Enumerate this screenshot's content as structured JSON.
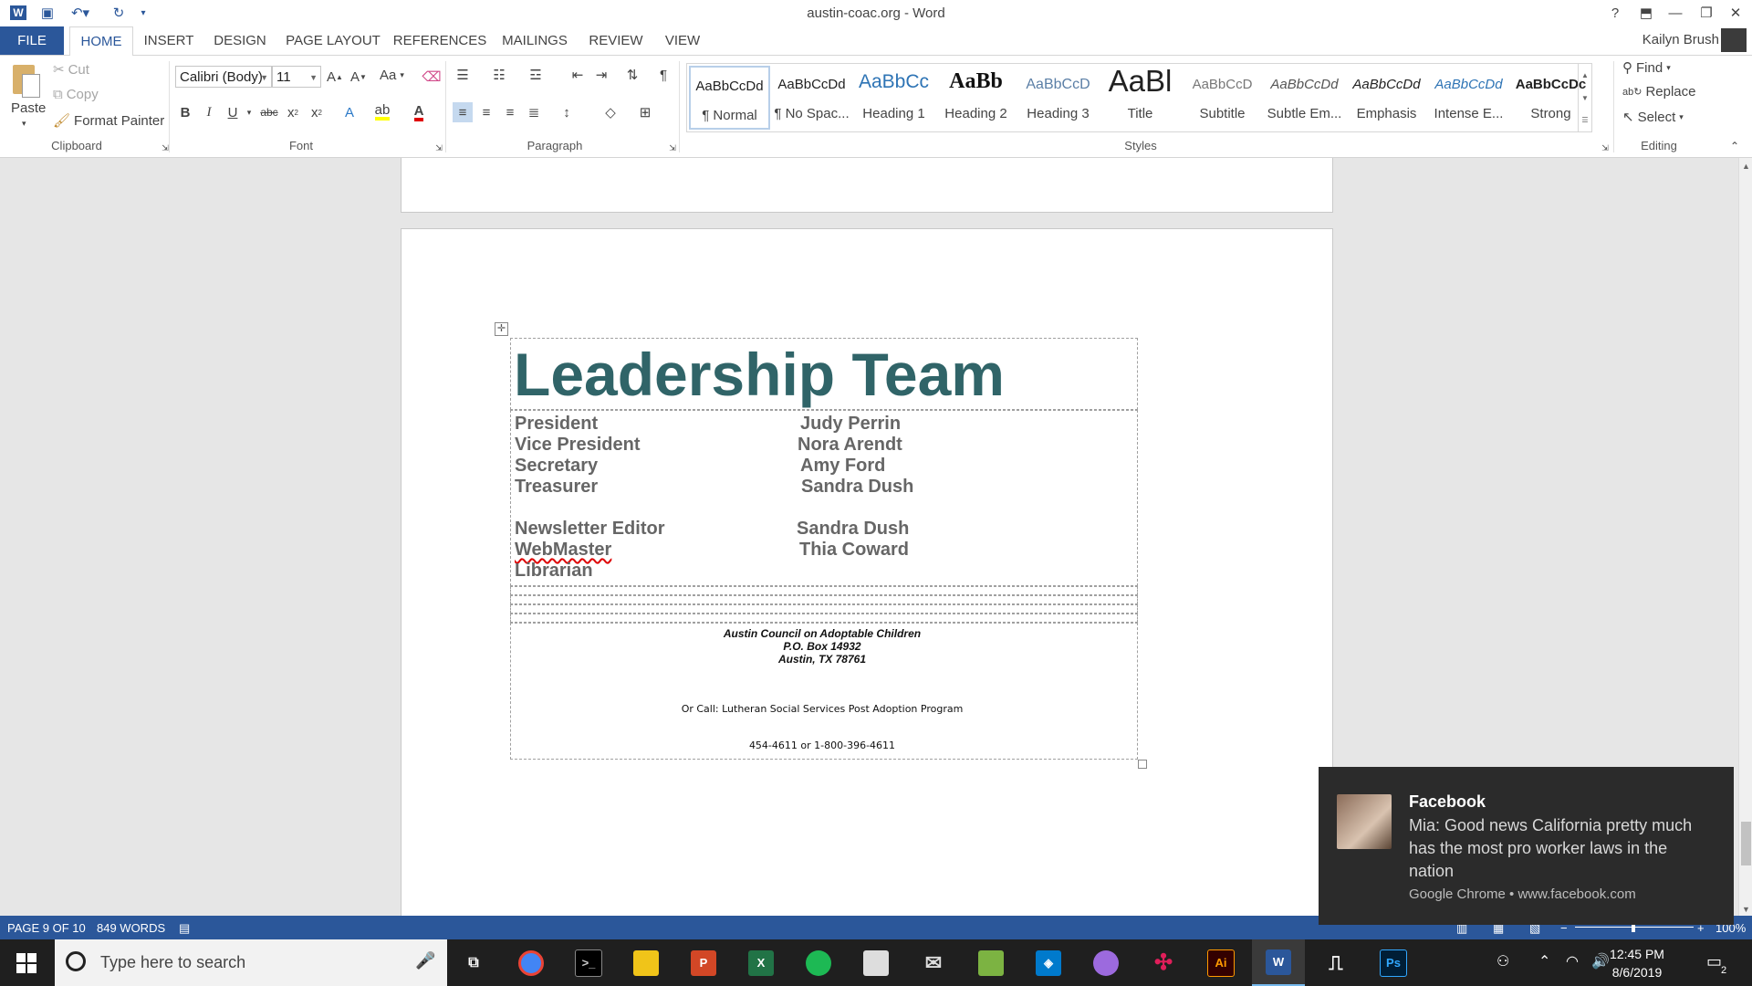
{
  "window": {
    "title": "austin-coac.org - Word",
    "user": "Kailyn Brush"
  },
  "quick_access": {
    "icons": [
      "word-logo-icon",
      "save-icon",
      "undo-icon",
      "redo-icon",
      "customize-icon"
    ]
  },
  "tabs": [
    "FILE",
    "HOME",
    "INSERT",
    "DESIGN",
    "PAGE LAYOUT",
    "REFERENCES",
    "MAILINGS",
    "REVIEW",
    "VIEW"
  ],
  "active_tab": "HOME",
  "clipboard": {
    "paste": "Paste",
    "cut": "Cut",
    "copy": "Copy",
    "format_painter": "Format Painter",
    "label": "Clipboard"
  },
  "font": {
    "name": "Calibri (Body)",
    "size": "11",
    "case_btn": "Aa",
    "label": "Font"
  },
  "paragraph": {
    "label": "Paragraph"
  },
  "styles": {
    "label": "Styles",
    "items": [
      {
        "sample": "AaBbCcDd",
        "name": "¶ Normal"
      },
      {
        "sample": "AaBbCcDd",
        "name": "¶ No Spac..."
      },
      {
        "sample": "AaBbCc",
        "name": "Heading 1"
      },
      {
        "sample": "AaBb",
        "name": "Heading 2"
      },
      {
        "sample": "AaBbCcD",
        "name": "Heading 3"
      },
      {
        "sample": "AaBl",
        "name": "Title"
      },
      {
        "sample": "AaBbCcD",
        "name": "Subtitle"
      },
      {
        "sample": "AaBbCcDd",
        "name": "Subtle Em..."
      },
      {
        "sample": "AaBbCcDd",
        "name": "Emphasis"
      },
      {
        "sample": "AaBbCcDd",
        "name": "Intense E..."
      },
      {
        "sample": "AaBbCcDc",
        "name": "Strong"
      }
    ]
  },
  "editing": {
    "find": "Find",
    "replace": "Replace",
    "select": "Select",
    "label": "Editing"
  },
  "document": {
    "heading": "Leadership Team",
    "roles": [
      {
        "role": "President",
        "person": "Judy Perrin"
      },
      {
        "role": "Vice President",
        "person": "Nora Arendt"
      },
      {
        "role": "Secretary",
        "person": "Amy Ford"
      },
      {
        "role": "Treasurer",
        "person": "Sandra Dush"
      },
      {
        "role": "Newsletter Editor",
        "person": "Sandra Dush"
      },
      {
        "role": "WebMaster",
        "person": "Thia Coward"
      },
      {
        "role": "Librarian",
        "person": ""
      }
    ],
    "footer": {
      "org": "Austin Council on Adoptable Children",
      "box": "P.O. Box 14932",
      "city": "Austin, TX 78761",
      "call": "Or Call: Lutheran Social Services Post Adoption Program",
      "phone": "454-4611 or 1-800-396-4611"
    }
  },
  "status": {
    "page": "PAGE 9 OF 10",
    "words": "849 WORDS",
    "zoom": "100%"
  },
  "notification": {
    "app": "Facebook",
    "message": "Mia: Good news California pretty much has the most pro worker laws in the nation",
    "source": "Google Chrome • www.facebook.com"
  },
  "taskbar": {
    "search_placeholder": "Type here to search",
    "apps": [
      {
        "name": "task-view",
        "glyph": "⧉"
      },
      {
        "name": "chrome",
        "glyph": "●",
        "color": "#4285f4"
      },
      {
        "name": "terminal",
        "glyph": ">_",
        "color": "#cccccc"
      },
      {
        "name": "file-explorer",
        "glyph": "▬",
        "color": "#f0c419"
      },
      {
        "name": "powerpoint",
        "glyph": "P",
        "color": "#d24726"
      },
      {
        "name": "excel",
        "glyph": "X",
        "color": "#217346"
      },
      {
        "name": "spotify",
        "glyph": "◉",
        "color": "#1db954"
      },
      {
        "name": "store",
        "glyph": "▣",
        "color": "#dddddd"
      },
      {
        "name": "mail",
        "glyph": "✉",
        "color": "#dddddd"
      },
      {
        "name": "photos",
        "glyph": "▤",
        "color": "#7cb342"
      },
      {
        "name": "vscode",
        "glyph": "◈",
        "color": "#007acc"
      },
      {
        "name": "github",
        "glyph": "◍",
        "color": "#9c6ade"
      },
      {
        "name": "slack",
        "glyph": "✣",
        "color": "#e01e5a"
      },
      {
        "name": "illustrator",
        "glyph": "Ai",
        "color": "#ff9a00"
      },
      {
        "name": "word",
        "glyph": "W",
        "color": "#2b579a"
      },
      {
        "name": "voice-recorder",
        "glyph": "🎙",
        "color": "#ffffff"
      },
      {
        "name": "photoshop",
        "glyph": "Ps",
        "color": "#31a8ff"
      }
    ],
    "time": "12:45 PM",
    "date": "8/6/2019",
    "notif_count": "2"
  },
  "colors": {
    "accent": "#2b579a",
    "heading": "#306468",
    "toast": "#2b2b2b"
  }
}
